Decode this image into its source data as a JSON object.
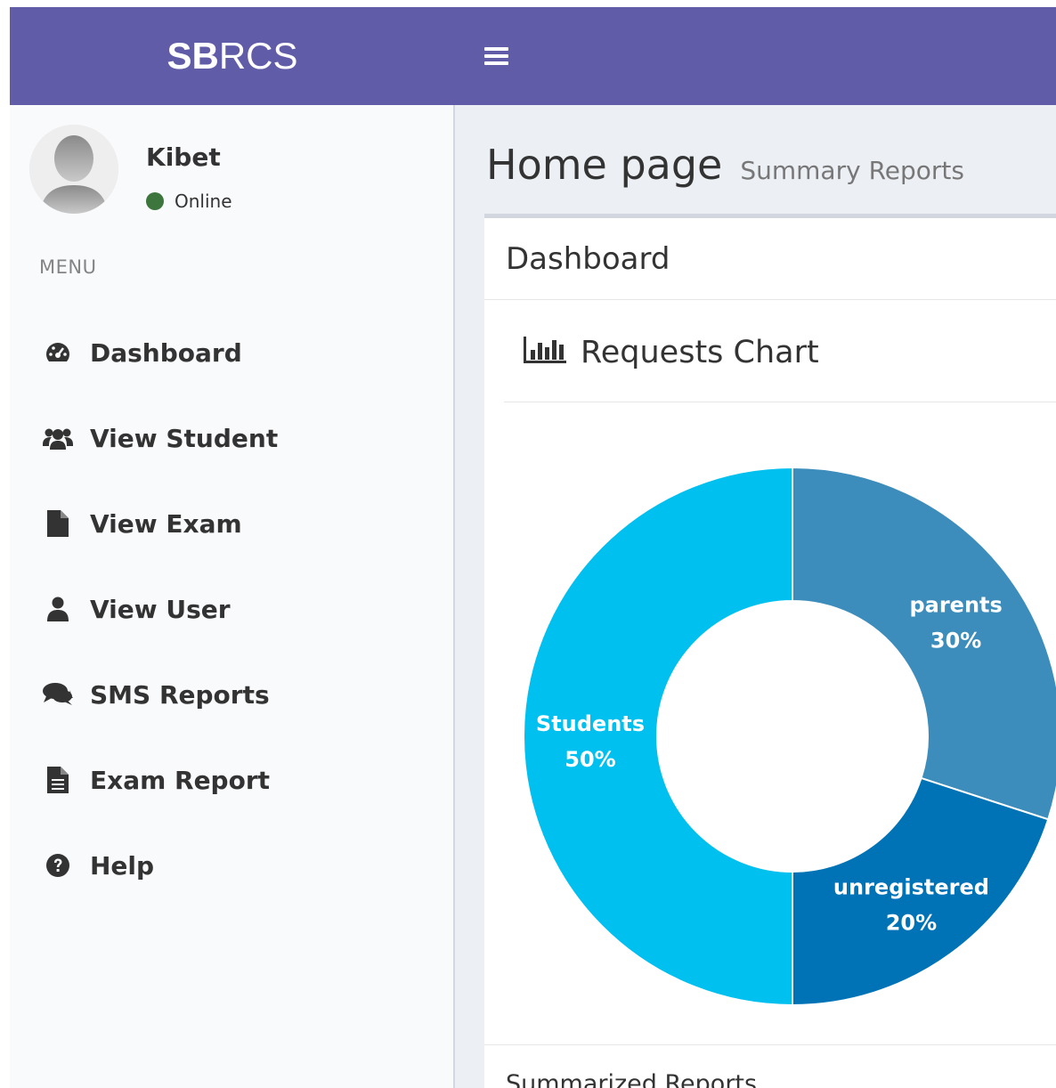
{
  "brand": {
    "bold": "SB",
    "light": "RCS"
  },
  "user": {
    "name": "Kibet",
    "status": "Online"
  },
  "menu": {
    "header": "MENU",
    "items": [
      {
        "label": "Dashboard",
        "icon": "dashboard-icon"
      },
      {
        "label": "View Student",
        "icon": "users-icon"
      },
      {
        "label": "View Exam",
        "icon": "file-icon"
      },
      {
        "label": "View User",
        "icon": "user-icon"
      },
      {
        "label": "SMS Reports",
        "icon": "comments-icon"
      },
      {
        "label": "Exam Report",
        "icon": "file-text-icon"
      },
      {
        "label": "Help",
        "icon": "question-circle-icon"
      }
    ]
  },
  "page": {
    "title": "Home page",
    "subtitle": "Summary Reports"
  },
  "box": {
    "title": "Dashboard",
    "chart_title": "Requests Chart",
    "footer_title": "Summarized Reports"
  },
  "colors": {
    "header": "#605ca8",
    "sidebar": "#f9fafc",
    "status": "#3c763d"
  },
  "chart_data": {
    "type": "pie",
    "donut": true,
    "slices": [
      {
        "label": "parents",
        "value": 30,
        "display": "30%",
        "color": "#3c8dbc"
      },
      {
        "label": "unregistered",
        "value": 20,
        "display": "20%",
        "color": "#0073b7"
      },
      {
        "label": "Students",
        "value": 50,
        "display": "50%",
        "color": "#00c0ef"
      }
    ]
  }
}
